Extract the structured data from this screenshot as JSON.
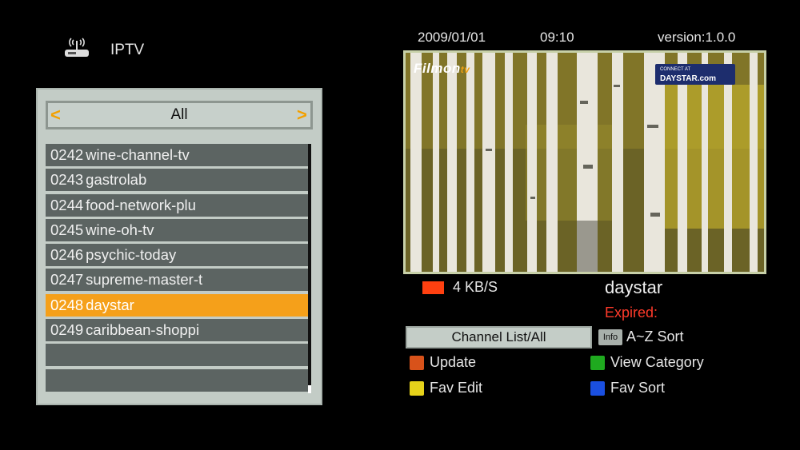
{
  "header": {
    "title": "IPTV",
    "date": "2009/01/01",
    "time": "09:10",
    "version": "version:1.0.0"
  },
  "category": {
    "label": "All",
    "prev_arrow": "<",
    "next_arrow": ">"
  },
  "channels": [
    {
      "number": "0242",
      "name": "wine-channel-tv",
      "selected": false
    },
    {
      "number": "0243",
      "name": "gastrolab",
      "selected": false
    },
    {
      "number": "0244",
      "name": "food-network-plu",
      "selected": false
    },
    {
      "number": "0245",
      "name": "wine-oh-tv",
      "selected": false
    },
    {
      "number": "0246",
      "name": "psychic-today",
      "selected": false
    },
    {
      "number": "0247",
      "name": "supreme-master-t",
      "selected": false
    },
    {
      "number": "0248",
      "name": "daystar",
      "selected": true
    },
    {
      "number": "0249",
      "name": "caribbean-shoppi",
      "selected": false
    },
    {
      "number": "",
      "name": "",
      "selected": false
    },
    {
      "number": "",
      "name": "",
      "selected": false
    }
  ],
  "preview": {
    "watermark": "Filmon",
    "watermark_suffix": "tv",
    "badge_top": "CONNECT AT",
    "badge_main": "DAYSTAR.com"
  },
  "status": {
    "speed": "4 KB/S",
    "channel_name": "daystar",
    "expired": "Expired:",
    "speed_color": "#ff4010",
    "expired_color": "#ff3a2a"
  },
  "controls": {
    "channel_list": "Channel List/All",
    "info_key": "Info",
    "info_action": "A~Z Sort",
    "red": {
      "label": "Update",
      "color": "#d8521a"
    },
    "green": {
      "label": "View Category",
      "color": "#1faa1f"
    },
    "yellow": {
      "label": "Fav Edit",
      "color": "#e6d21a"
    },
    "blue": {
      "label": "Fav Sort",
      "color": "#1a4fe0"
    }
  }
}
